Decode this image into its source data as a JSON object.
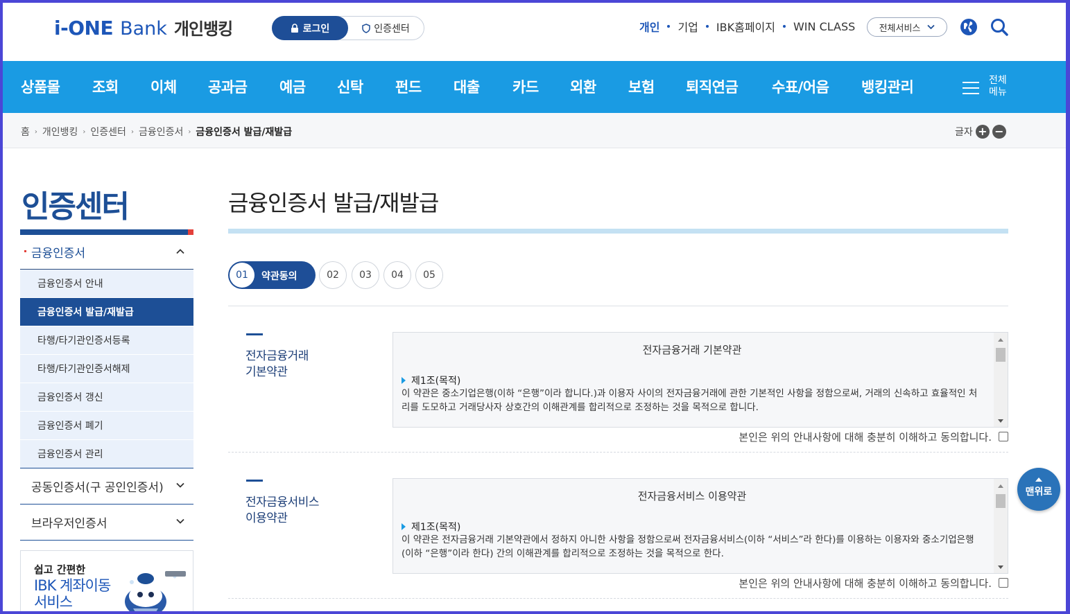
{
  "header": {
    "logo_brand": "i-ONE",
    "logo_bank": "Bank",
    "logo_sub": "개인뱅킹",
    "login_label": "로그인",
    "cert_center_label": "인증센터",
    "util_links": [
      "개인",
      "기업",
      "IBK홈페이지",
      "WIN CLASS"
    ],
    "all_services_label": "전체서비스",
    "brand_color": "#1d56b8"
  },
  "nav": {
    "items": [
      "상품몰",
      "조회",
      "이체",
      "공과금",
      "예금",
      "신탁",
      "펀드",
      "대출",
      "카드",
      "외환",
      "보험",
      "퇴직연금",
      "수표/어음",
      "뱅킹관리"
    ],
    "all_menu_label": "전체\n메뉴",
    "bg_color": "#1a9be3"
  },
  "breadcrumb": {
    "items": [
      "홈",
      "개인뱅킹",
      "인증센터",
      "금융인증서"
    ],
    "current": "금융인증서 발급/재발급",
    "font_size_label": "글자",
    "font_plus": "+",
    "font_minus": "−"
  },
  "sidebar": {
    "title": "인증센터",
    "groups": [
      {
        "label": "금융인증서",
        "expanded": true,
        "items": [
          "금융인증서 안내",
          "금융인증서 발급/재발급",
          "타행/타기관인증서등록",
          "타행/타기관인증서해제",
          "금융인증서 갱신",
          "금융인증서 폐기",
          "금융인증서 관리"
        ],
        "active_index": 1
      },
      {
        "label": "공동인증서(구 공인인증서)",
        "expanded": false
      },
      {
        "label": "브라우저인증서",
        "expanded": false
      }
    ],
    "promo": {
      "line1": "쉽고 간편한",
      "line2": "IBK 계좌이동 서비스"
    }
  },
  "content": {
    "title": "금융인증서 발급/재발급",
    "steps": {
      "active_num": "01",
      "active_label": "약관동의",
      "others": [
        "02",
        "03",
        "04",
        "05"
      ]
    },
    "terms": [
      {
        "name": "전자금융거래\n기본약관",
        "box_title": "전자금융거래 기본약관",
        "article": "제1조(목적)",
        "body": "이 약관은 중소기업은행(이하 “은행”이라 합니다.)과 이용자 사이의 전자금융거래에 관한 기본적인 사항을 정함으로써, 거래의 신속하고 효율적인 처리를 도모하고 거래당사자 상호간의 이해관계를 합리적으로 조정하는 것을 목적으로 합니다.",
        "agree": "본인은 위의 안내사항에 대해 충분히 이해하고 동의합니다."
      },
      {
        "name": "전자금융서비스\n이용약관",
        "box_title": "전자금융서비스 이용약관",
        "article": "제1조(목적)",
        "body": "이 약관은 전자금융거래 기본약관에서 정하지 아니한 사항을 정함으로써 전자금융서비스(이하 “서비스”라 한다)를 이용하는 이용자와 중소기업은행(이하 “은행”이라 한다) 간의 이해관계를 합리적으로 조정하는 것을 목적으로 한다.",
        "agree": "본인은 위의 안내사항에 대해 충분히 이해하고 동의합니다."
      }
    ],
    "top_button_label": "맨위로"
  }
}
